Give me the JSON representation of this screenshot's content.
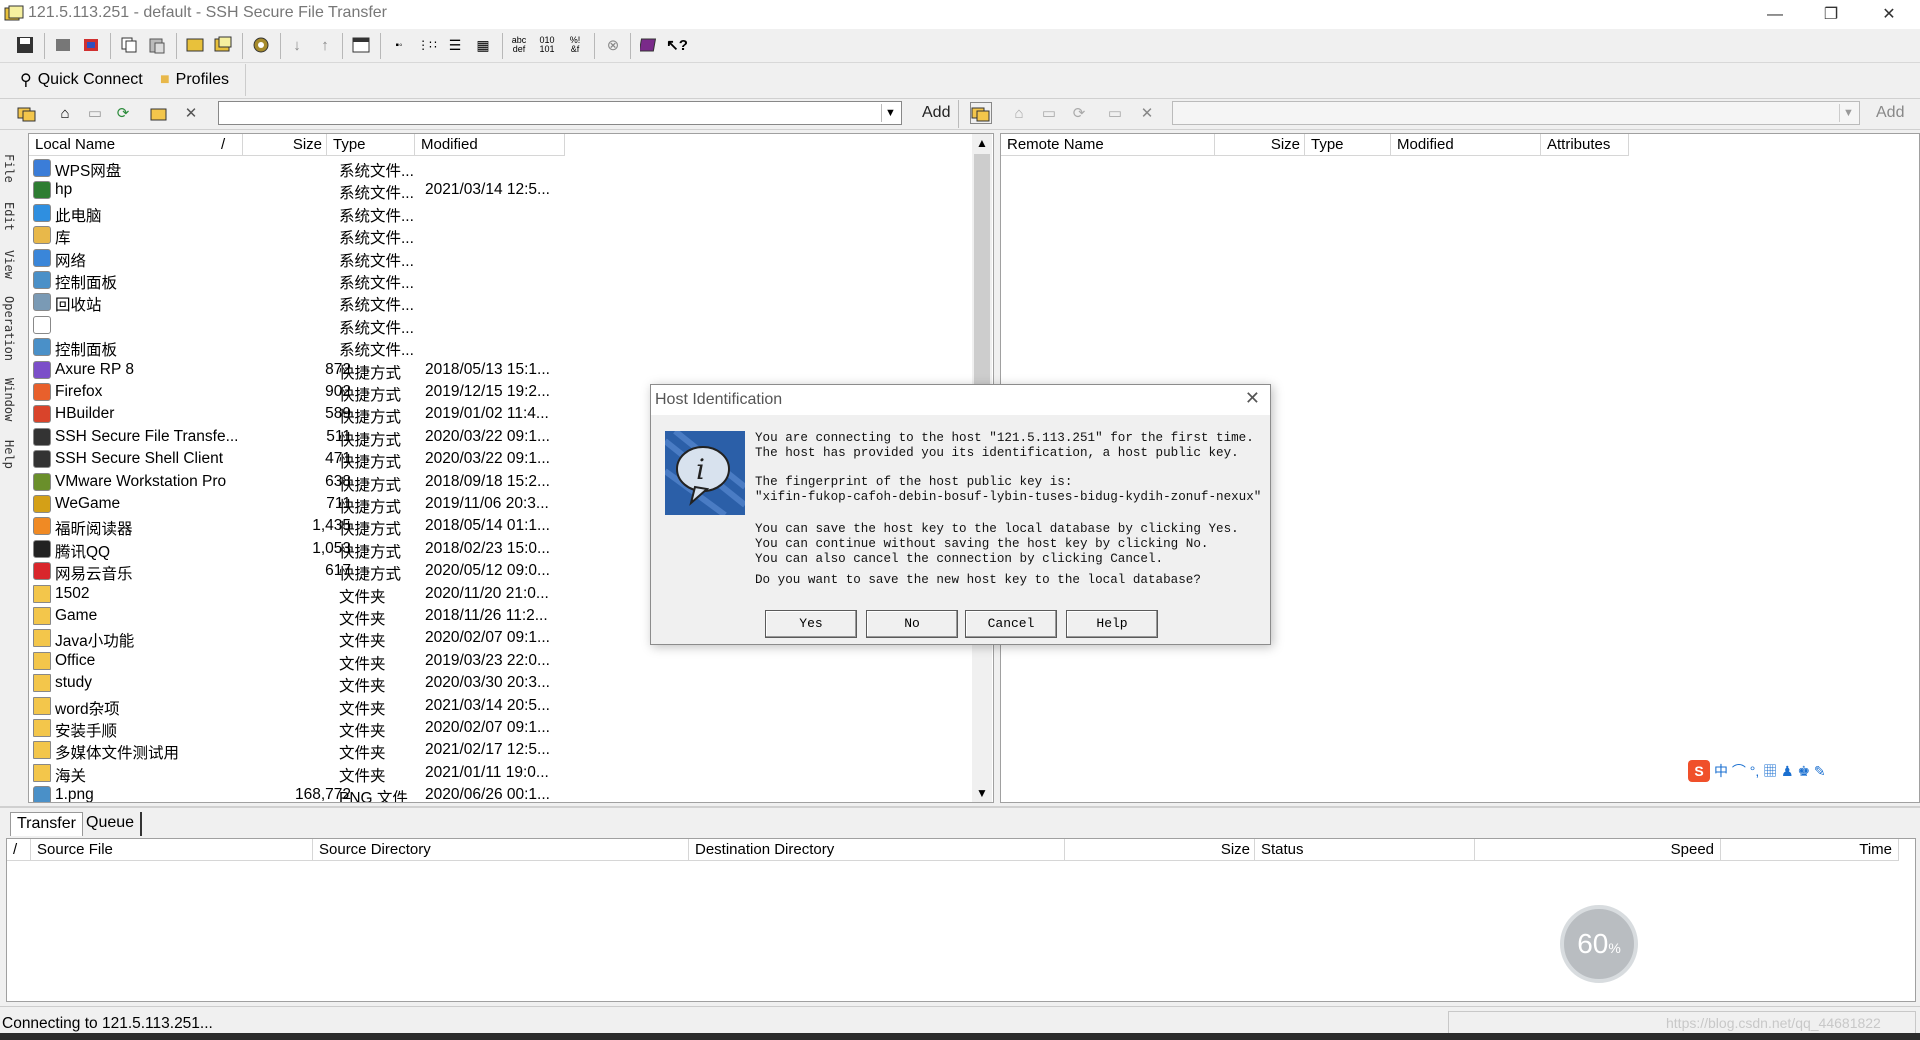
{
  "window": {
    "title": "121.5.113.251 - default - SSH Secure File Transfer",
    "controls": [
      "—",
      "❐",
      "✕"
    ]
  },
  "quickbar": {
    "quick_connect": "Quick Connect",
    "profiles": "Profiles"
  },
  "addr": {
    "local_add": "Add",
    "remote_add": "Add"
  },
  "sidemenu": [
    "File",
    "Edit",
    "View",
    "Operation",
    "Window",
    "Help"
  ],
  "local": {
    "headers": {
      "name": "Local Name",
      "sort": "/",
      "size": "Size",
      "type": "Type",
      "modified": "Modified"
    },
    "rows": [
      {
        "name": "WPS网盘",
        "size": "",
        "type": "系统文件...",
        "modified": "",
        "icon": "cloud-icon",
        "color": "#3b7dd8"
      },
      {
        "name": "hp",
        "size": "",
        "type": "系统文件...",
        "modified": "2021/03/14 12:5...",
        "icon": "user-icon",
        "color": "#2e7d32"
      },
      {
        "name": "此电脑",
        "size": "",
        "type": "系统文件...",
        "modified": "",
        "icon": "computer-icon",
        "color": "#2f8fe0"
      },
      {
        "name": "库",
        "size": "",
        "type": "系统文件...",
        "modified": "",
        "icon": "library-icon",
        "color": "#e8b84a"
      },
      {
        "name": "网络",
        "size": "",
        "type": "系统文件...",
        "modified": "",
        "icon": "network-icon",
        "color": "#3a86d9"
      },
      {
        "name": "控制面板",
        "size": "",
        "type": "系统文件...",
        "modified": "",
        "icon": "control-panel-icon",
        "color": "#4a90c8"
      },
      {
        "name": "回收站",
        "size": "",
        "type": "系统文件...",
        "modified": "",
        "icon": "recycle-bin-icon",
        "color": "#7a9ab5"
      },
      {
        "name": "",
        "size": "",
        "type": "系统文件...",
        "modified": "",
        "icon": "blank-file-icon",
        "color": "#ffffff"
      },
      {
        "name": "控制面板",
        "size": "",
        "type": "系统文件...",
        "modified": "",
        "icon": "control-panel-icon",
        "color": "#4a90c8"
      },
      {
        "name": "Axure RP 8",
        "size": "872",
        "type": "快捷方式",
        "modified": "2018/05/13 15:1...",
        "icon": "axure-icon",
        "color": "#7b4fc9"
      },
      {
        "name": "Firefox",
        "size": "902",
        "type": "快捷方式",
        "modified": "2019/12/15 19:2...",
        "icon": "firefox-icon",
        "color": "#e8602c"
      },
      {
        "name": "HBuilder",
        "size": "589",
        "type": "快捷方式",
        "modified": "2019/01/02 11:4...",
        "icon": "hbuilder-icon",
        "color": "#d9442b"
      },
      {
        "name": "SSH Secure File Transfe...",
        "size": "511",
        "type": "快捷方式",
        "modified": "2020/03/22 09:1...",
        "icon": "ssh-ft-icon",
        "color": "#333333"
      },
      {
        "name": "SSH Secure Shell Client",
        "size": "471",
        "type": "快捷方式",
        "modified": "2020/03/22 09:1...",
        "icon": "ssh-shell-icon",
        "color": "#333333"
      },
      {
        "name": "VMware Workstation Pro",
        "size": "638",
        "type": "快捷方式",
        "modified": "2018/09/18 15:2...",
        "icon": "vmware-icon",
        "color": "#6a8f2b"
      },
      {
        "name": "WeGame",
        "size": "711",
        "type": "快捷方式",
        "modified": "2019/11/06 20:3...",
        "icon": "wegame-icon",
        "color": "#d4a017"
      },
      {
        "name": "福昕阅读器",
        "size": "1,435",
        "type": "快捷方式",
        "modified": "2018/05/14 01:1...",
        "icon": "foxit-icon",
        "color": "#f08a24"
      },
      {
        "name": "腾讯QQ",
        "size": "1,053",
        "type": "快捷方式",
        "modified": "2018/02/23 15:0...",
        "icon": "qq-icon",
        "color": "#222222"
      },
      {
        "name": "网易云音乐",
        "size": "617",
        "type": "快捷方式",
        "modified": "2020/05/12 09:0...",
        "icon": "netease-music-icon",
        "color": "#d9262b"
      },
      {
        "name": "1502",
        "size": "",
        "type": "文件夹",
        "modified": "2020/11/20 21:0...",
        "icon": "folder-icon",
        "color": "#f3c64b"
      },
      {
        "name": "Game",
        "size": "",
        "type": "文件夹",
        "modified": "2018/11/26 11:2...",
        "icon": "folder-icon",
        "color": "#f3c64b"
      },
      {
        "name": "Java小功能",
        "size": "",
        "type": "文件夹",
        "modified": "2020/02/07 09:1...",
        "icon": "folder-icon",
        "color": "#f3c64b"
      },
      {
        "name": "Office",
        "size": "",
        "type": "文件夹",
        "modified": "2019/03/23 22:0...",
        "icon": "folder-icon",
        "color": "#f3c64b"
      },
      {
        "name": "study",
        "size": "",
        "type": "文件夹",
        "modified": "2020/03/30 20:3...",
        "icon": "folder-icon",
        "color": "#f3c64b"
      },
      {
        "name": "word杂项",
        "size": "",
        "type": "文件夹",
        "modified": "2021/03/14 20:5...",
        "icon": "folder-icon",
        "color": "#f3c64b"
      },
      {
        "name": "安装手顺",
        "size": "",
        "type": "文件夹",
        "modified": "2020/02/07 09:1...",
        "icon": "folder-icon",
        "color": "#f3c64b"
      },
      {
        "name": "多媒体文件测试用",
        "size": "",
        "type": "文件夹",
        "modified": "2021/02/17 12:5...",
        "icon": "folder-icon",
        "color": "#f3c64b"
      },
      {
        "name": "海关",
        "size": "",
        "type": "文件夹",
        "modified": "2021/01/11 19:0...",
        "icon": "folder-icon",
        "color": "#f3c64b"
      },
      {
        "name": "1.png",
        "size": "168,772",
        "type": "PNG 文件",
        "modified": "2020/06/26 00:1...",
        "icon": "image-file-icon",
        "color": "#4a90c8"
      }
    ]
  },
  "remote": {
    "headers": {
      "name": "Remote Name",
      "size": "Size",
      "type": "Type",
      "modified": "Modified",
      "attributes": "Attributes"
    }
  },
  "tabs": {
    "transfer": "Transfer",
    "queue": "Queue"
  },
  "transfer": {
    "headers": {
      "sort": "/",
      "source_file": "Source File",
      "source_dir": "Source Directory",
      "dest_dir": "Destination Directory",
      "size": "Size",
      "status": "Status",
      "speed": "Speed",
      "time": "Time"
    }
  },
  "status": {
    "text": "Connecting to 121.5.113.251...",
    "watermark": "https://blog.csdn.net/qq_44681822"
  },
  "dialog": {
    "title": "Host Identification",
    "close": "✕",
    "text1": "You are connecting to the host \"121.5.113.251\" for the first time.\nThe host has provided you its identification, a host public key.",
    "text2": "The fingerprint of the host public key is:\n\"xifin-fukop-cafoh-debin-bosuf-lybin-tuses-bidug-kydih-zonuf-nexux\"",
    "text3": "You can save the host key to the local database by clicking Yes.\nYou can continue without saving the host key by clicking No.\nYou can also cancel the connection by clicking Cancel.",
    "text4": "Do you want to save the new host key to the local database?",
    "buttons": {
      "yes": "Yes",
      "no": "No",
      "cancel": "Cancel",
      "help": "Help"
    }
  },
  "ime": {
    "brand": "S",
    "items": "中 ⌒ °, ▦ ♟ ♚ ✎"
  },
  "progress_widget": {
    "value": "60",
    "unit": "%"
  }
}
